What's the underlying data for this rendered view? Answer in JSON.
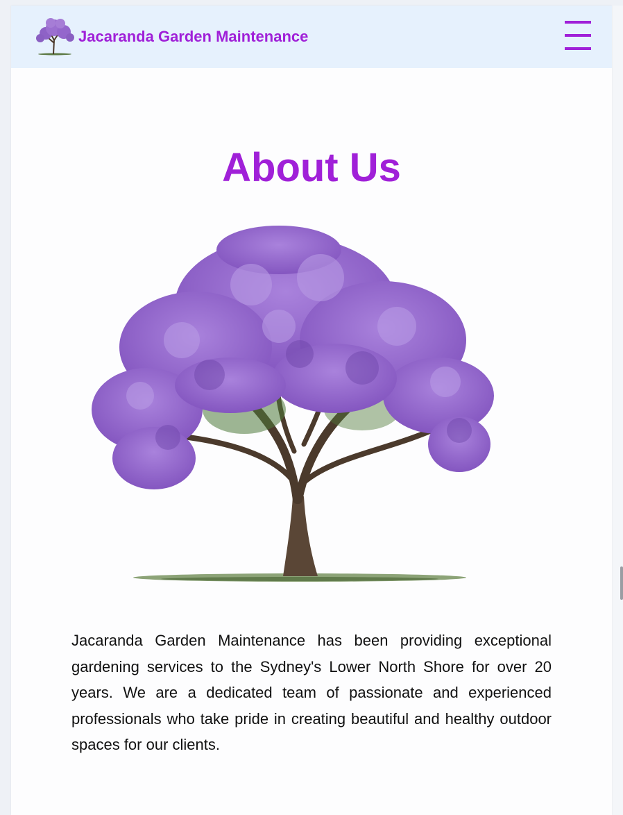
{
  "header": {
    "brand_name": "Jacaranda Garden Maintenance",
    "logo_icon": "jacaranda-tree-icon",
    "menu_icon": "hamburger-menu-icon"
  },
  "about": {
    "title": "About Us",
    "image_subject": "jacaranda-tree",
    "body": "Jacaranda Garden Maintenance has been providing exceptional gardening services to the Sydney's Lower North Shore for over 20 years. We are a dedicated team of passionate and experienced professionals who take pride in creating beautiful and healthy outdoor spaces for our clients."
  },
  "colors": {
    "accent": "#a020d8",
    "header_background": "#e6f1fd",
    "page_background": "#fdfdfe",
    "body_text": "#111111",
    "blossom": "#9b6fd0"
  }
}
